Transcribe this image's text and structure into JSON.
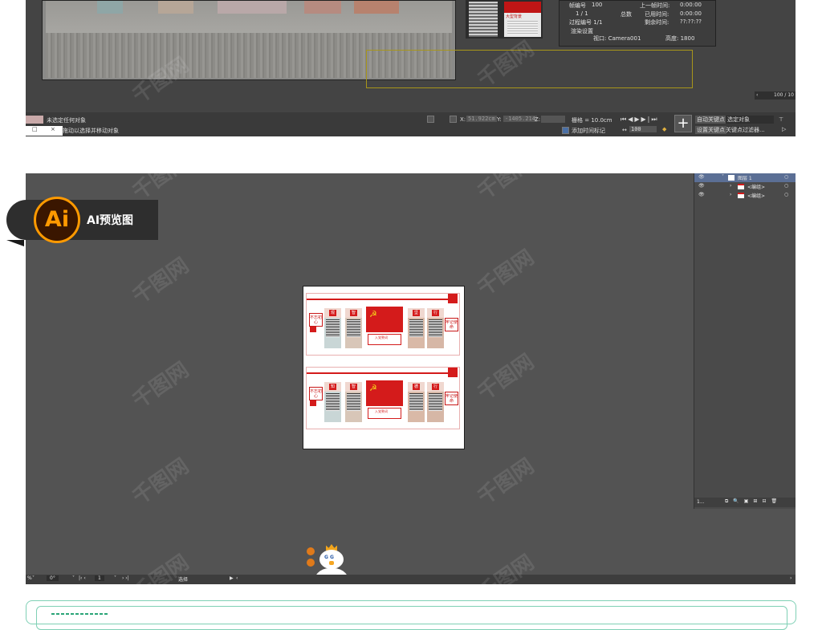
{
  "max_panel": {
    "render_dialog": {
      "frame_label": "帧编号",
      "frame_value": "100",
      "frame_fraction": "1 / 1",
      "total_label": "总数",
      "last_frame_time_label": "上一帧时间:",
      "last_frame_time_value": "0:00:00",
      "elapsed_time_label": "已用时间:",
      "elapsed_time_value": "0:00:00",
      "process_label": "过程编号 1/1",
      "remaining_time_label": "剩余时间:",
      "remaining_time_value": "??:??:??",
      "render_settings_label": "渲染设置",
      "viewport_label": "视口: Camera001",
      "height_label": "高度: 1800"
    },
    "thumb_caption": "大型背景",
    "frame_counter": "100 / 10",
    "status": {
      "no_selection": "未选定任何对象",
      "hint": "拖动以选择并移动对象",
      "x_label": "X:",
      "x_value": "51.922cm",
      "y_label": "Y:",
      "y_value": "-1405.214",
      "z_label": "Z:",
      "grid_label": "栅格 = 10.0cm",
      "add_time_tag": "添加时间标记",
      "auto_key": "自动关键点",
      "selected_objects": "选定对象",
      "set_key": "设置关键点",
      "key_filters": "关键点过滤器...",
      "frame_input": "100"
    }
  },
  "ai_panel": {
    "layers": [
      {
        "name": "图层 1"
      },
      {
        "name": "<编组>"
      },
      {
        "name": "<编组>"
      }
    ],
    "layers_footer_count": "1...",
    "footer": {
      "zoom": "%",
      "rotation": "0°",
      "artboard_index": "1",
      "tool": "选择"
    },
    "artboard": {
      "designs": [
        {
          "left_label": "不忘初心",
          "right_label": "牢记使命",
          "panel_titles": [
            "观",
            "智",
            "",
            "坚",
            "行"
          ],
          "center_title": "入党誓词"
        },
        {
          "left_label": "不忘初心",
          "right_label": "牢记使命",
          "panel_titles": [
            "知",
            "智",
            "",
            "德",
            "行"
          ],
          "center_title": "入党誓词"
        }
      ]
    }
  },
  "badge": {
    "logo_text": "Ai",
    "label": "AI预览图"
  },
  "watermark_text": "千图网",
  "colors": {
    "party_red": "#d41b1b",
    "ai_orange": "#ff9a00",
    "bottom_card_border": "#7fd0b5"
  }
}
